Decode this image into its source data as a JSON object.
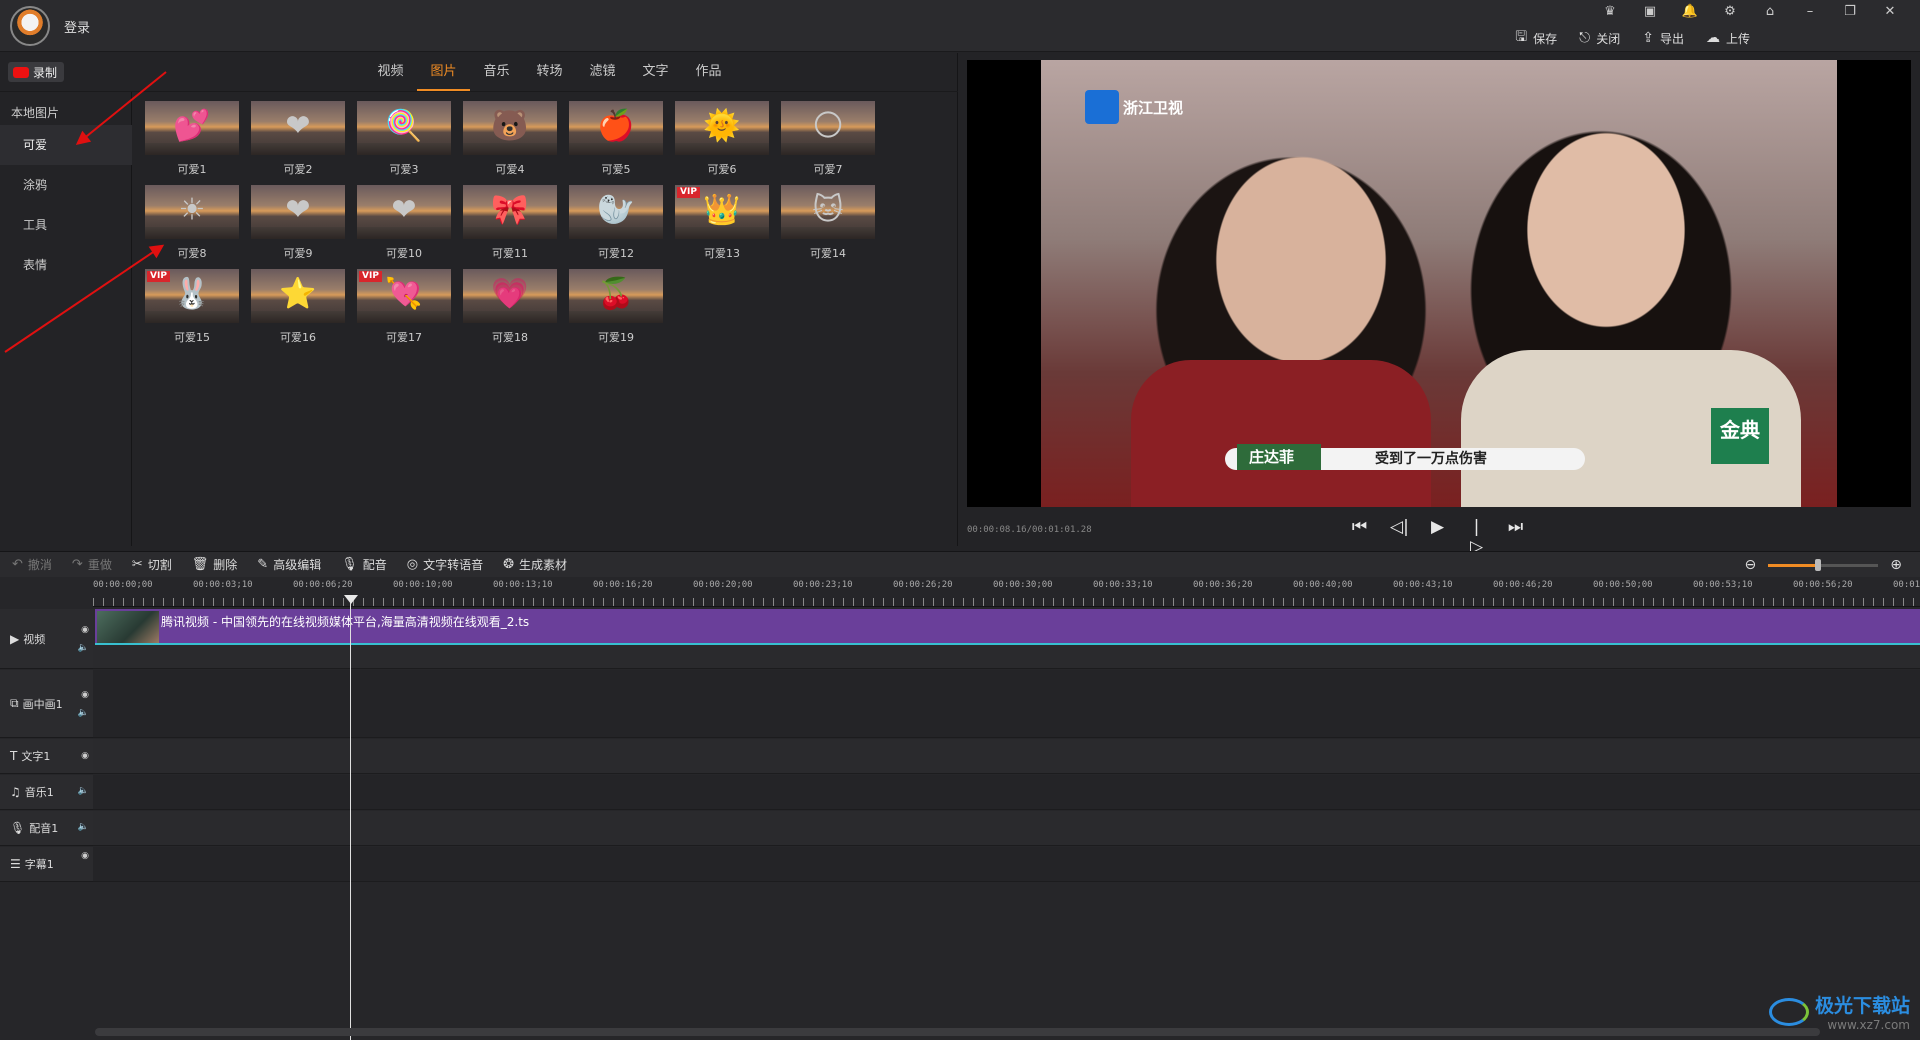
{
  "header": {
    "login_label": "登录",
    "window_icons": [
      "crown-icon",
      "play-box-icon",
      "bell-icon",
      "gear-icon",
      "home-icon",
      "minimize-icon",
      "restore-icon",
      "close-icon"
    ],
    "actions": [
      {
        "label": "保存",
        "icon": "save-icon"
      },
      {
        "label": "关闭",
        "icon": "exit-icon"
      },
      {
        "label": "导出",
        "icon": "export-icon"
      },
      {
        "label": "上传",
        "icon": "upload-icon"
      }
    ]
  },
  "media": {
    "record_label": "录制",
    "tabs": [
      "视频",
      "图片",
      "音乐",
      "转场",
      "滤镜",
      "文字",
      "作品"
    ],
    "active_tab": "图片",
    "sidebar": {
      "heading": "本地图片",
      "items": [
        "可爱",
        "涂鸦",
        "工具",
        "表情"
      ],
      "active": "可爱"
    },
    "items": [
      {
        "label": "可爱1",
        "glyph": "💕"
      },
      {
        "label": "可爱2",
        "glyph": "❤"
      },
      {
        "label": "可爱3",
        "glyph": "🍭"
      },
      {
        "label": "可爱4",
        "glyph": "🐻"
      },
      {
        "label": "可爱5",
        "glyph": "🍎"
      },
      {
        "label": "可爱6",
        "glyph": "🌞"
      },
      {
        "label": "可爱7",
        "glyph": "🌕"
      },
      {
        "label": "可爱8",
        "glyph": "☀"
      },
      {
        "label": "可爱9",
        "glyph": "❤"
      },
      {
        "label": "可爱10",
        "glyph": "❤"
      },
      {
        "label": "可爱11",
        "glyph": "🎀"
      },
      {
        "label": "可爱12",
        "glyph": "🦭"
      },
      {
        "label": "可爱13",
        "glyph": "👑",
        "vip": "VIP"
      },
      {
        "label": "可爱14",
        "glyph": "🐱"
      },
      {
        "label": "可爱15",
        "glyph": "🐰",
        "vip": "VIP"
      },
      {
        "label": "可爱16",
        "glyph": "⭐"
      },
      {
        "label": "可爱17",
        "glyph": "💘",
        "vip": "VIP"
      },
      {
        "label": "可爱18",
        "glyph": "💗"
      },
      {
        "label": "可爱19",
        "glyph": "🍒"
      }
    ]
  },
  "preview": {
    "channel_logo": "浙江卫视",
    "name_tag": "庄达菲",
    "caption": "受到了一万点伤害",
    "sponsor": "金典",
    "timecode": "00:00:08.16/00:01:01.28",
    "controls": [
      "skip-start-icon",
      "step-back-icon",
      "play-icon",
      "step-forward-icon",
      "skip-end-icon"
    ]
  },
  "edit_toolbar": {
    "tools": [
      {
        "label": "撤消",
        "icon": "undo-icon",
        "disabled": true
      },
      {
        "label": "重做",
        "icon": "redo-icon",
        "disabled": true
      },
      {
        "label": "切割",
        "icon": "scissors-icon"
      },
      {
        "label": "删除",
        "icon": "trash-icon"
      },
      {
        "label": "高级编辑",
        "icon": "pencil-icon"
      },
      {
        "label": "配音",
        "icon": "mic-icon"
      },
      {
        "label": "文字转语音",
        "icon": "tts-icon"
      },
      {
        "label": "生成素材",
        "icon": "material-icon"
      }
    ],
    "zoom_level": 0.45
  },
  "timeline": {
    "ruler": [
      "00:00:00;00",
      "00:00:03;10",
      "00:00:06;20",
      "00:00:10;00",
      "00:00:13;10",
      "00:00:16;20",
      "00:00:20;00",
      "00:00:23;10",
      "00:00:26;20",
      "00:00:30;00",
      "00:00:33;10",
      "00:00:36;20",
      "00:00:40;00",
      "00:00:43;10",
      "00:00:46;20",
      "00:00:50;00",
      "00:00:53;10",
      "00:00:56;20",
      "00:01"
    ],
    "tracks": [
      {
        "label": "视频",
        "icon": "video-track-icon"
      },
      {
        "label": "画中画1",
        "icon": "pip-track-icon"
      },
      {
        "label": "文字1",
        "icon": "text-track-icon"
      },
      {
        "label": "音乐1",
        "icon": "music-track-icon"
      },
      {
        "label": "配音1",
        "icon": "mic-track-icon"
      },
      {
        "label": "字幕1",
        "icon": "subtitle-track-icon"
      }
    ],
    "clip_name": "腾讯视频 - 中国领先的在线视频媒体平台,海量高清视频在线观看_2.ts"
  },
  "watermark": {
    "title": "极光下载站",
    "url": "www.xz7.com"
  }
}
